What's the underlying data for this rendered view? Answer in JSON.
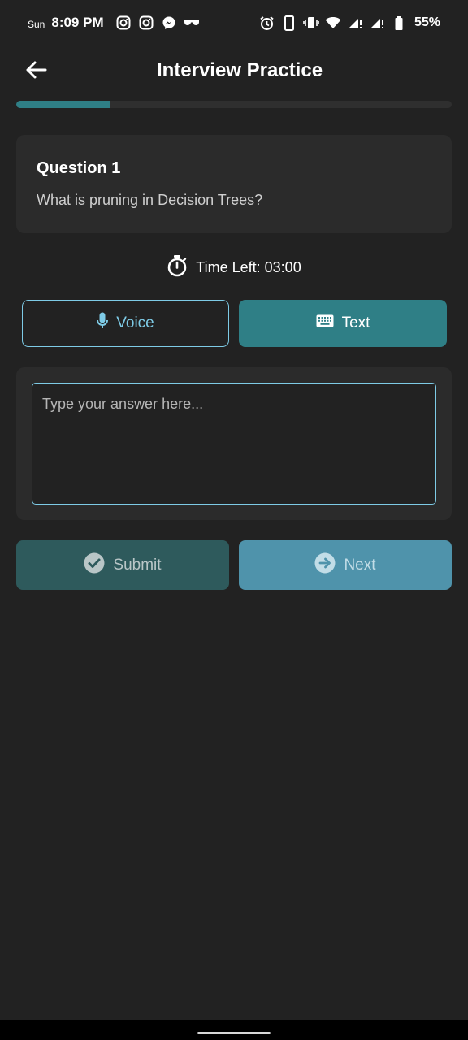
{
  "status_bar": {
    "day": "Sun",
    "time": "8:09 PM",
    "left_icons": [
      "instagram-icon",
      "instagram-icon",
      "messenger-icon",
      "glasses-icon"
    ],
    "right_icons": [
      "alarm-icon",
      "phone-icon",
      "vibrate-icon",
      "wifi-icon",
      "signal-icon",
      "signal-icon",
      "battery-icon"
    ],
    "battery": "55%"
  },
  "app_bar": {
    "title": "Interview Practice",
    "back_icon": "arrow-left-icon"
  },
  "progress": {
    "fraction": 0.214,
    "color": "#2f7f86"
  },
  "question": {
    "title": "Question 1",
    "text": "What is pruning in Decision Trees?"
  },
  "timer": {
    "icon": "stopwatch-icon",
    "text": "Time Left: 03:00"
  },
  "mode": {
    "voice_label": "Voice",
    "voice_icon": "microphone-icon",
    "text_label": "Text",
    "text_icon": "keyboard-icon",
    "selected": "Text"
  },
  "answer": {
    "value": "",
    "placeholder": "Type your answer here..."
  },
  "actions": {
    "submit_label": "Submit",
    "submit_icon": "check-circle-icon",
    "next_label": "Next",
    "next_icon": "arrow-right-circle-icon"
  },
  "colors": {
    "background": "#222222",
    "card": "#2b2b2b",
    "accent": "#2f7f86",
    "outline": "#7ecbe6"
  }
}
